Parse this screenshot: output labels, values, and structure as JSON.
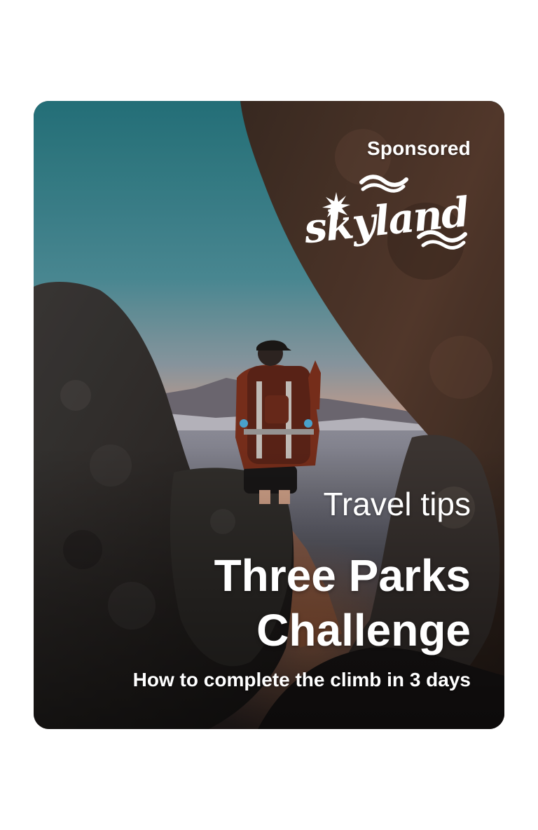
{
  "card": {
    "sponsored_label": "Sponsored",
    "brand_logo_text": "skyland",
    "kicker": "Travel tips",
    "title": "Three Parks Challenge",
    "subtitle": "How to complete the climb in 3 days"
  },
  "colors": {
    "page_background": "#ffffff",
    "text": "#ffffff",
    "sky_top": "#2f7f86",
    "sky_horizon": "#e5a788",
    "rock_dark": "#2a2624",
    "rock_warm": "#4a3024",
    "jacket": "#7a2f1c"
  },
  "icons": {
    "brand_mark": "sunburst-icon",
    "waves": "waves-icon",
    "photo": "hiker-photo"
  }
}
